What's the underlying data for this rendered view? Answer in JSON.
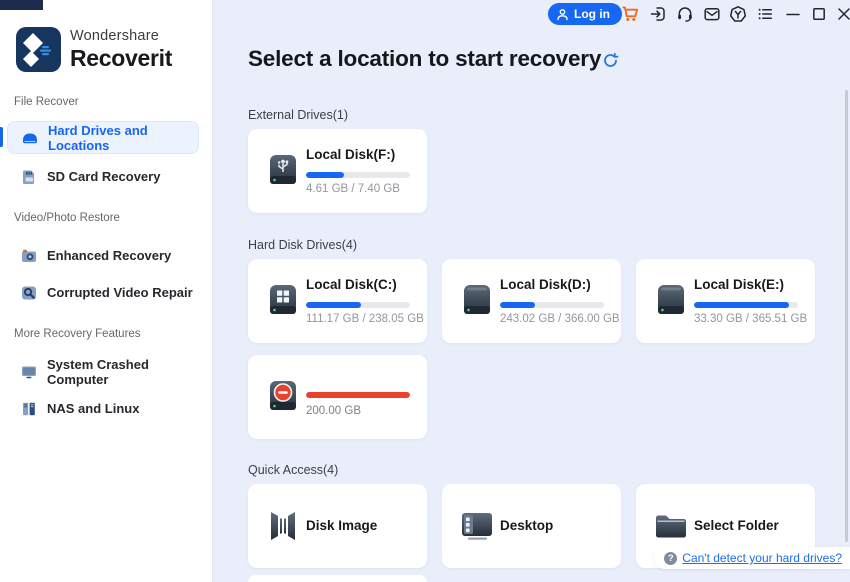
{
  "brand": {
    "company": "Wondershare",
    "product": "Recoverit"
  },
  "topbar": {
    "login_label": "Log in",
    "icon_names": [
      "user-icon",
      "cart-icon",
      "signin-icon",
      "headset-icon",
      "mail-icon",
      "toolkit-icon",
      "menu-list-icon",
      "minimize-icon",
      "maximize-icon",
      "close-icon"
    ],
    "cart_color": "#f2671f",
    "login_color": "#1668f2"
  },
  "sidebar": {
    "sections": [
      {
        "label": "File Recover",
        "items": [
          {
            "label": "Hard Drives and Locations",
            "active": true,
            "icon": "hard-drive-icon"
          },
          {
            "label": "SD Card Recovery",
            "icon": "sd-card-icon"
          }
        ]
      },
      {
        "label": "Video/Photo Restore",
        "items": [
          {
            "label": "Enhanced Recovery",
            "icon": "camera-icon"
          },
          {
            "label": "Corrupted Video Repair",
            "icon": "video-repair-icon"
          }
        ]
      },
      {
        "label": "More Recovery Features",
        "items": [
          {
            "label": "System Crashed Computer",
            "icon": "crashed-computer-icon"
          },
          {
            "label": "NAS and Linux",
            "icon": "nas-server-icon"
          }
        ]
      }
    ]
  },
  "main": {
    "title": "Select a location to start recovery",
    "external": {
      "label": "External Drives(1)",
      "drives": [
        {
          "name": "Local Disk(F:)",
          "size": "4.61 GB / 7.40 GB",
          "used": "37%",
          "icon": "usb-drive-icon"
        }
      ]
    },
    "hdd": {
      "label": "Hard Disk Drives(4)",
      "drives": [
        {
          "name": "Local Disk(C:)",
          "size": "111.17 GB / 238.05 GB",
          "used": "53%",
          "icon": "system-drive-icon"
        },
        {
          "name": "Local Disk(D:)",
          "size": "243.02 GB / 366.00 GB",
          "used": "34%",
          "icon": "hdd-drive-icon"
        },
        {
          "name": "Local Disk(E:)",
          "size": "33.30 GB / 365.51 GB",
          "used": "91%",
          "icon": "hdd-drive-icon"
        },
        {
          "name": "",
          "size": "200.00 GB",
          "used": "100%",
          "icon": "blocked-drive-icon",
          "bar_color": "danger"
        }
      ]
    },
    "quick": {
      "label": "Quick Access(4)",
      "items": [
        {
          "label": "Disk Image",
          "icon": "disk-image-icon"
        },
        {
          "label": "Desktop",
          "icon": "desktop-icon"
        },
        {
          "label": "Select Folder",
          "icon": "folder-icon"
        }
      ]
    },
    "help_q": "?",
    "help_link": "Can't detect your hard drives?"
  },
  "colors": {
    "accent": "#1767f2",
    "danger": "#e8442c",
    "main_bg": "#e9eefa",
    "logo_navy": "#16355f"
  }
}
